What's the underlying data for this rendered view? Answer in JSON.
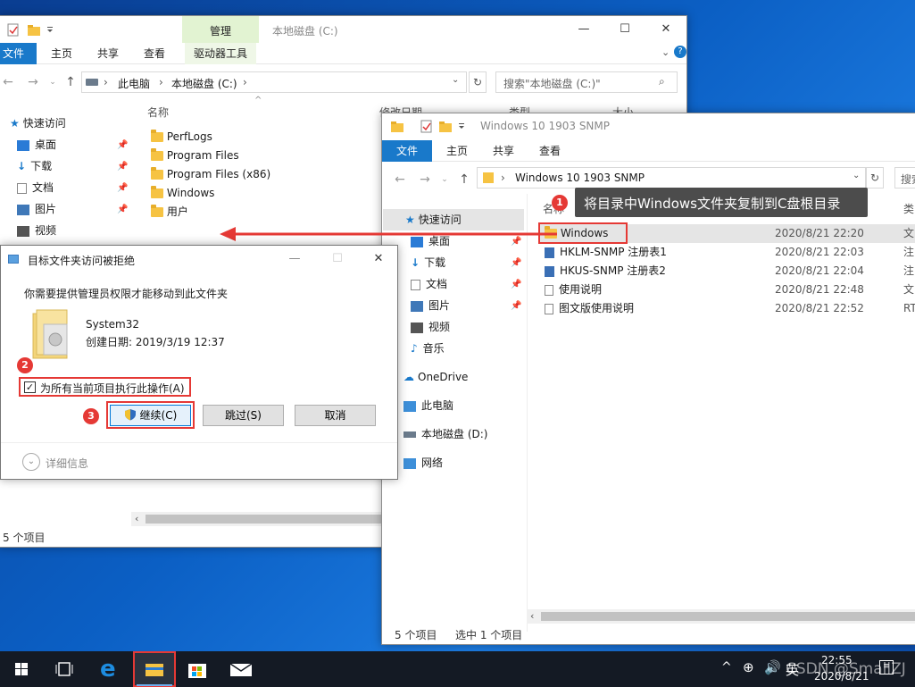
{
  "win1": {
    "title": "本地磁盘 (C:)",
    "ribbon_context_label": "管理",
    "tabs": [
      "文件",
      "主页",
      "共享",
      "查看",
      "驱动器工具"
    ],
    "breadcrumb": [
      "此电脑",
      "本地磁盘 (C:)"
    ],
    "search_placeholder": "搜索\"本地磁盘 (C:)\"",
    "col_name": "名称",
    "col_date": "修改日期",
    "col_type": "类型",
    "col_size": "大小",
    "files": [
      "PerfLogs",
      "Program Files",
      "Program Files (x86)",
      "Windows",
      "用户"
    ],
    "nav": [
      {
        "label": "快速访问",
        "icon": "star-icon"
      },
      {
        "label": "桌面",
        "icon": "desktop-icon"
      },
      {
        "label": "下载",
        "icon": "download-icon"
      },
      {
        "label": "文档",
        "icon": "document-icon"
      },
      {
        "label": "图片",
        "icon": "picture-icon"
      },
      {
        "label": "视频",
        "icon": "video-icon"
      }
    ],
    "status": "5 个项目"
  },
  "win2": {
    "title": "Windows 10  1903 SNMP",
    "tabs": [
      "文件",
      "主页",
      "共享",
      "查看"
    ],
    "breadcrumb": "Windows 10  1903 SNMP",
    "search_placeholder": "搜索",
    "col_name": "名称",
    "col_type": "类",
    "nav": [
      {
        "label": "快速访问",
        "icon": "star-icon"
      },
      {
        "label": "桌面",
        "icon": "desktop-icon"
      },
      {
        "label": "下载",
        "icon": "download-icon"
      },
      {
        "label": "文档",
        "icon": "document-icon"
      },
      {
        "label": "图片",
        "icon": "picture-icon"
      },
      {
        "label": "视频",
        "icon": "video-icon"
      },
      {
        "label": "音乐",
        "icon": "music-icon"
      },
      {
        "label": "OneDrive",
        "icon": "cloud-icon"
      },
      {
        "label": "此电脑",
        "icon": "computer-icon"
      },
      {
        "label": "本地磁盘 (D:)",
        "icon": "drive-icon"
      },
      {
        "label": "网络",
        "icon": "network-icon"
      }
    ],
    "files": [
      {
        "name": "Windows",
        "date": "2020/8/21 22:20",
        "type": "文"
      },
      {
        "name": "HKLM-SNMP 注册表1",
        "date": "2020/8/21 22:03",
        "type": "注"
      },
      {
        "name": "HKUS-SNMP 注册表2",
        "date": "2020/8/21 22:04",
        "type": "注"
      },
      {
        "name": "使用说明",
        "date": "2020/8/21 22:48",
        "type": "文"
      },
      {
        "name": "图文版使用说明",
        "date": "2020/8/21 22:52",
        "type": "RT"
      }
    ],
    "status_count": "5 个项目",
    "status_selected": "选中 1 个项目"
  },
  "annotation1": {
    "number": "1",
    "text": "将目录中Windows文件夹复制到C盘根目录"
  },
  "annotation2": {
    "number": "2"
  },
  "annotation3": {
    "number": "3"
  },
  "dialog": {
    "title": "目标文件夹访问被拒绝",
    "message": "你需要提供管理员权限才能移动到此文件夹",
    "item_name": "System32",
    "item_date": "创建日期: 2019/3/19 12:37",
    "checkbox_label": "为所有当前项目执行此操作(A)",
    "continue": "继续(C)",
    "skip": "跳过(S)",
    "cancel": "取消",
    "details": "详细信息"
  },
  "taskbar": {
    "time": "22:55",
    "date": "2020/8/21",
    "ime": "英",
    "watermark": "CSDN @SmallZJ"
  },
  "colors": {
    "accent": "#1979ca",
    "annotation_red": "#e53935",
    "taskbar": "#141a24"
  }
}
